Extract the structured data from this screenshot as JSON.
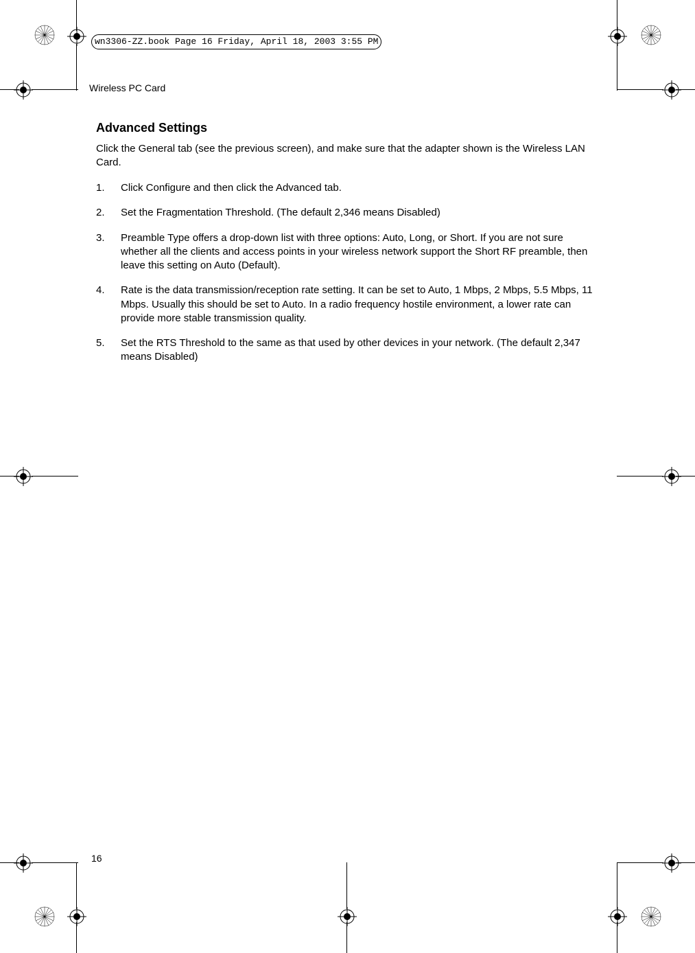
{
  "header_box": "wn3306-ZZ.book  Page 16  Friday, April 18, 2003  3:55 PM",
  "running_header": "Wireless PC Card",
  "section_title": "Advanced Settings",
  "intro": "Click the General tab (see the previous screen), and make sure that the adapter shown is the Wireless LAN Card.",
  "items": [
    "Click Configure and then click the Advanced tab.",
    "Set the Fragmentation Threshold. (The default 2,346 means Disabled)",
    "Preamble Type offers a drop-down list with three options: Auto, Long, or Short. If you are not sure whether all the clients and access points in your wireless network support the Short RF preamble, then leave this setting on Auto (Default).",
    "Rate is the data transmission/reception rate setting. It can be set to Auto, 1 Mbps, 2 Mbps, 5.5 Mbps, 11 Mbps. Usually this should be set to Auto. In a radio frequency hostile environment, a lower rate can provide more stable transmission quality.",
    "Set the RTS Threshold to the same as that used by other devices in your network. (The default 2,347 means Disabled)"
  ],
  "page_number": "16"
}
